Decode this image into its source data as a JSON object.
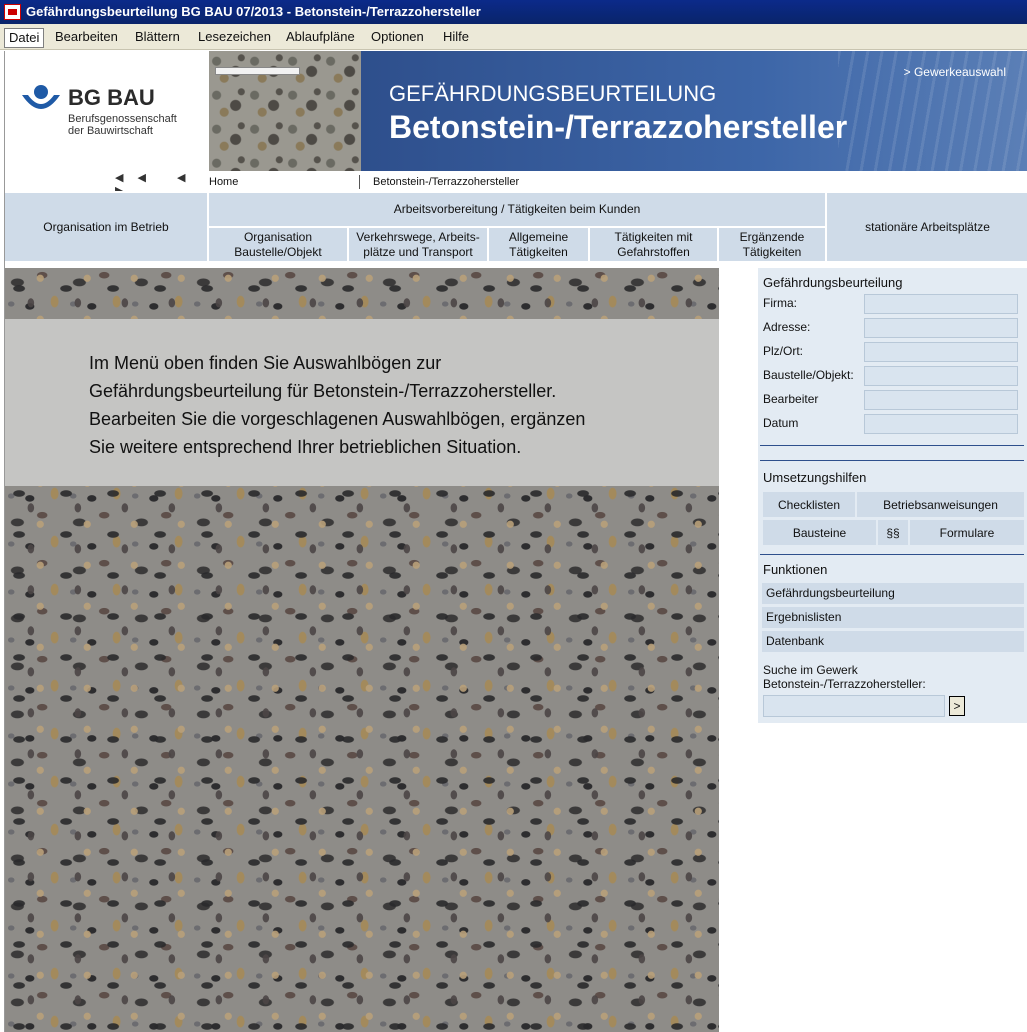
{
  "window": {
    "title": "Gefährdungsbeurteilung BG BAU 07/2013 - Betonstein-/Terrazzohersteller"
  },
  "menu": {
    "items": [
      "Datei",
      "Bearbeiten",
      "Blättern",
      "Lesezeichen",
      "Ablaufpläne",
      "Optionen",
      "Hilfe"
    ]
  },
  "logo": {
    "name": "BG BAU",
    "sub1": "Berufsgenossenschaft",
    "sub2": "der Bauwirtschaft"
  },
  "nav_arrows": {
    "first": "◀◀",
    "prev": "◀",
    "next": "▶"
  },
  "header": {
    "kicker": "GEFÄHRDUNGSBEURTEILUNG",
    "title": "Betonstein-/Terrazzohersteller",
    "link": "> Gewerkeauswahl"
  },
  "breadcrumb": {
    "home": "Home",
    "current": "Betonstein-/Terrazzohersteller"
  },
  "nav": {
    "org_betrieb": "Organisation im Betrieb",
    "arbeitsvorbereitung": "Arbeitsvorbereitung / Tätigkeiten beim Kunden",
    "stationaer": "stationäre Arbeitsplätze",
    "sub": [
      {
        "l1": "Organisation",
        "l2": "Baustelle/Objekt"
      },
      {
        "l1": "Verkehrswege, Arbeits-",
        "l2": "plätze und Transport"
      },
      {
        "l1": "Allgemeine",
        "l2": "Tätigkeiten"
      },
      {
        "l1": "Tätigkeiten mit",
        "l2": "Gefahrstoffen"
      },
      {
        "l1": "Ergänzende",
        "l2": "Tätigkeiten"
      }
    ]
  },
  "intro": {
    "lines": [
      "Im Menü oben finden Sie Auswahlbögen zur",
      "Gefährdungsbeurteilung für Betonstein-/Terrazzohersteller.",
      "Bearbeiten Sie die vorgeschlagenen Auswahlbögen, ergänzen",
      "Sie weitere entsprechend Ihrer betrieblichen Situation."
    ]
  },
  "sidebar": {
    "gb_title": "Gefährdungsbeurteilung",
    "fields": [
      {
        "label": "Firma:",
        "value": ""
      },
      {
        "label": "Adresse:",
        "value": ""
      },
      {
        "label": "Plz/Ort:",
        "value": ""
      },
      {
        "label": "Baustelle/Objekt:",
        "value": ""
      },
      {
        "label": "Bearbeiter",
        "value": ""
      },
      {
        "label": "Datum",
        "value": ""
      }
    ],
    "umsetzung_title": "Umsetzungshilfen",
    "checklisten": "Checklisten",
    "betriebsanweisungen": "Betriebsanweisungen",
    "bausteine": "Bausteine",
    "paragraphs": "§§",
    "formulare": "Formulare",
    "funktionen_title": "Funktionen",
    "funktionen": [
      "Gefährdungsbeurteilung",
      "Ergebnislisten",
      "Datenbank"
    ],
    "search_label": "Suche im Gewerk Betonstein-/Terrazzohersteller:",
    "search_value": "",
    "search_button": ">"
  }
}
